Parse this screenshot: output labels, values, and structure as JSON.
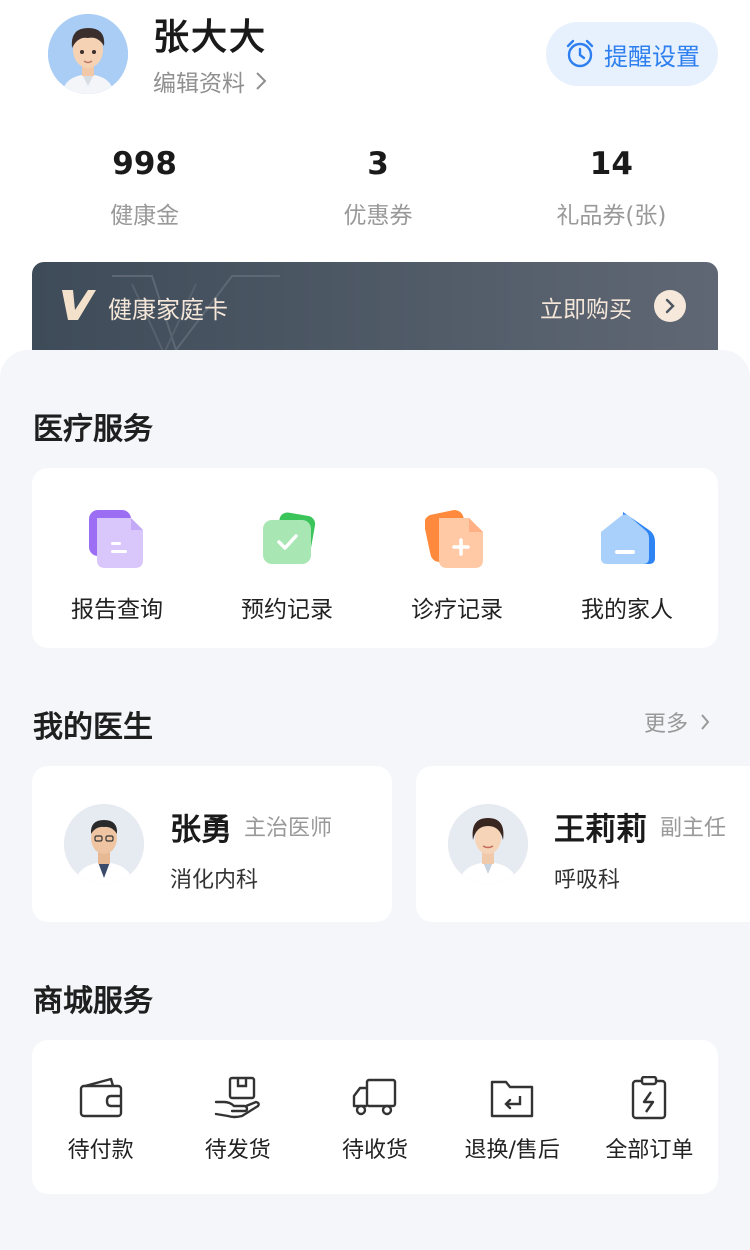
{
  "user": {
    "name": "张大大",
    "edit_label": "编辑资料",
    "reminder_label": "提醒设置"
  },
  "stats": [
    {
      "value": "998",
      "label": "健康金"
    },
    {
      "value": "3",
      "label": "优惠券"
    },
    {
      "value": "14",
      "label": "礼品券(张)"
    }
  ],
  "family_card": {
    "title": "健康家庭卡",
    "buy_label": "立即购买"
  },
  "medical": {
    "section_title": "医疗服务",
    "items": [
      {
        "label": "报告查询",
        "icon": "report-icon"
      },
      {
        "label": "预约记录",
        "icon": "appointment-icon"
      },
      {
        "label": "诊疗记录",
        "icon": "treatment-record-icon"
      },
      {
        "label": "我的家人",
        "icon": "family-home-icon"
      }
    ]
  },
  "doctors": {
    "section_title": "我的医生",
    "more_label": "更多",
    "list": [
      {
        "name": "张勇",
        "title": "主治医师",
        "dept": "消化内科"
      },
      {
        "name": "王莉莉",
        "title": "副主任",
        "dept": "呼吸科"
      }
    ]
  },
  "mall": {
    "section_title": "商城服务",
    "items": [
      {
        "label": "待付款",
        "icon": "wallet-icon"
      },
      {
        "label": "待发货",
        "icon": "package-hand-icon"
      },
      {
        "label": "待收货",
        "icon": "truck-icon"
      },
      {
        "label": "退换/售后",
        "icon": "return-folder-icon"
      },
      {
        "label": "全部订单",
        "icon": "clipboard-icon"
      }
    ]
  },
  "colors": {
    "accent": "#2d7ff0",
    "panel_bg": "#f4f6fa",
    "card_dark": "#46525e",
    "gold_text": "#f4e6d8"
  }
}
